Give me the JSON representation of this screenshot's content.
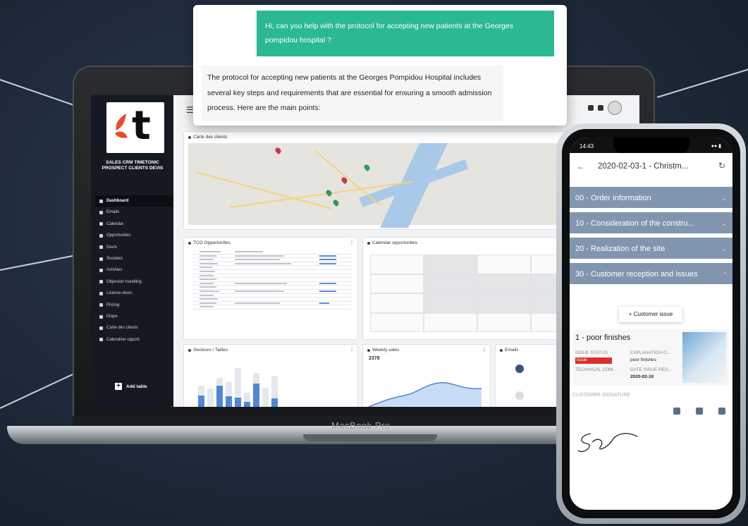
{
  "chat": {
    "user_message": "Hi, can you help with the protocol for accepting new patients at the Georges pompidou hospital ?",
    "bot_message": "The protocol for accepting new patients at the Georges Pompidou Hospital includes several key steps and requirements that are essential for ensuring a smooth admission process. Here are the main points:"
  },
  "laptop": {
    "brand": "MacBook Pro",
    "sidebar": {
      "app_name": "SALES CRM TIMETONIC PROSPECT CLIENTS DEVIS",
      "items": [
        {
          "label": "Dashboard",
          "active": true
        },
        {
          "label": "Emails"
        },
        {
          "label": "Calendar"
        },
        {
          "label": "Opportunites"
        },
        {
          "label": "Devis"
        },
        {
          "label": "Societes"
        },
        {
          "label": "Activites"
        },
        {
          "label": "Objection handling"
        },
        {
          "label": "Licence devis"
        },
        {
          "label": "Pricing"
        },
        {
          "label": "Etape"
        },
        {
          "label": "Carte des clients"
        },
        {
          "label": "Calendrier opport."
        }
      ],
      "add_table": "Add table"
    },
    "cards": {
      "map_title": "Carte des clients",
      "tco_title": "TCO Opportunites",
      "calendar_title": "Calendar opportunites",
      "secteurs_title": "Secteurs / Tailles",
      "weekly_title": "Weekly sales",
      "weekly_value": "2378",
      "emails_title": "Emails"
    },
    "chart_data": {
      "type": "bar",
      "series": [
        {
          "values": [
            0.35,
            0.12,
            0.55,
            0.33,
            0.3,
            0.22,
            0.58,
            0.12,
            0.28
          ]
        },
        {
          "values": [
            0.55,
            0.48,
            0.7,
            0.62,
            0.9,
            0.4,
            0.8,
            0.5,
            0.75
          ]
        }
      ]
    },
    "colors": {
      "accent": "#2bb992",
      "bar_blue": "#4f86d9",
      "sidebar": "#151a22"
    }
  },
  "phone": {
    "time": "14:43",
    "title": "2020-02-03-1 - Christm...",
    "sections": [
      "00 - Order information",
      "10 - Consideration of the constru...",
      "20 - Realization of the site",
      "30 - Customer reception and issues"
    ],
    "customer_issue_button": "+ Customer issue",
    "issue": {
      "title": "1 - poor finishes",
      "status_label": "ISSUE STATUS",
      "status_value": "Issue",
      "explanation_label": "EXPLANATION O...",
      "explanation_value": "poor finishes",
      "technical_label": "TECHNICAL COM...",
      "date_label": "DATE ISSUE RES...",
      "date_value": "2020-02-10"
    },
    "signature_label": "CUSTOMER SIGNATURE"
  }
}
